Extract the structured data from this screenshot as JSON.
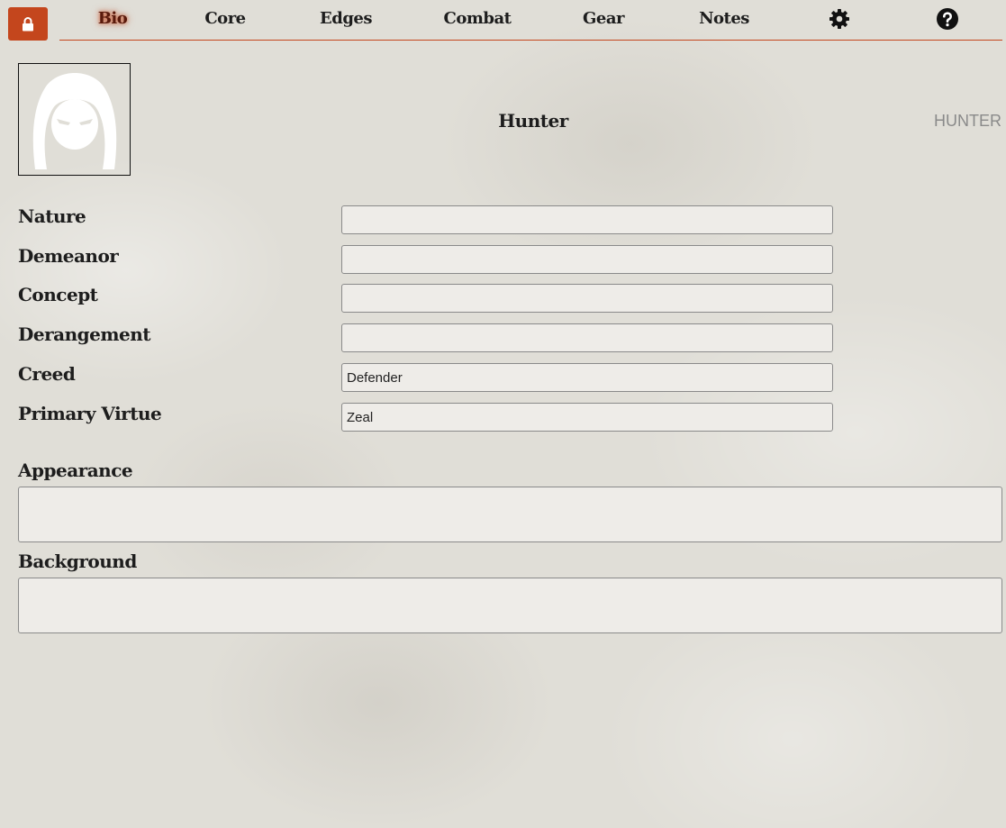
{
  "nav": {
    "lock_icon": "lock-icon",
    "tabs": [
      {
        "label": "Bio",
        "active": true
      },
      {
        "label": "Core",
        "active": false
      },
      {
        "label": "Edges",
        "active": false
      },
      {
        "label": "Combat",
        "active": false
      },
      {
        "label": "Gear",
        "active": false
      },
      {
        "label": "Notes",
        "active": false
      }
    ],
    "settings_icon": "gear-icon",
    "help_icon": "question-icon"
  },
  "colors": {
    "accent": "#c4461d",
    "paper": "#e0ded7",
    "input_bg": "#eeece8"
  },
  "header": {
    "portrait_icon": "hooded-figure-icon",
    "character_name": "Hunter",
    "game_label": "HUNTER"
  },
  "fields": [
    {
      "label": "Nature",
      "value": ""
    },
    {
      "label": "Demeanor",
      "value": ""
    },
    {
      "label": "Concept",
      "value": ""
    },
    {
      "label": "Derangement",
      "value": ""
    },
    {
      "label": "Creed",
      "value": "Defender"
    },
    {
      "label": "Primary Virtue",
      "value": "Zeal"
    }
  ],
  "text_areas": [
    {
      "label": "Appearance",
      "value": ""
    },
    {
      "label": "Background",
      "value": ""
    }
  ]
}
